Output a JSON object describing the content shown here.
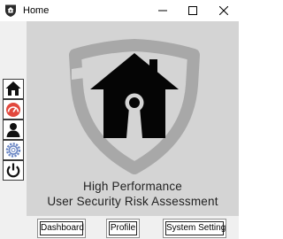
{
  "window": {
    "title": "Home"
  },
  "window_controls": [
    "minimize-icon",
    "maximize-icon",
    "close-icon"
  ],
  "sidebar": {
    "items": [
      {
        "name": "home",
        "icon": "home-icon"
      },
      {
        "name": "dashboard",
        "icon": "gauge-icon",
        "accent": "#e2483d"
      },
      {
        "name": "profile",
        "icon": "user-icon"
      },
      {
        "name": "settings",
        "icon": "gear-icon",
        "accent": "#6a86c4"
      },
      {
        "name": "power",
        "icon": "power-icon"
      }
    ]
  },
  "hero": {
    "icon": "shield-house-lock-icon",
    "line1": "High Performance",
    "line2": "User Security Risk Assessment"
  },
  "buttons": {
    "dashboard": "Dashboard",
    "profile": "Profile",
    "system_setting": "System Setting"
  },
  "colors": {
    "panel": "#d4d4d4",
    "shield": "#a8a8a8",
    "house": "#050505"
  }
}
